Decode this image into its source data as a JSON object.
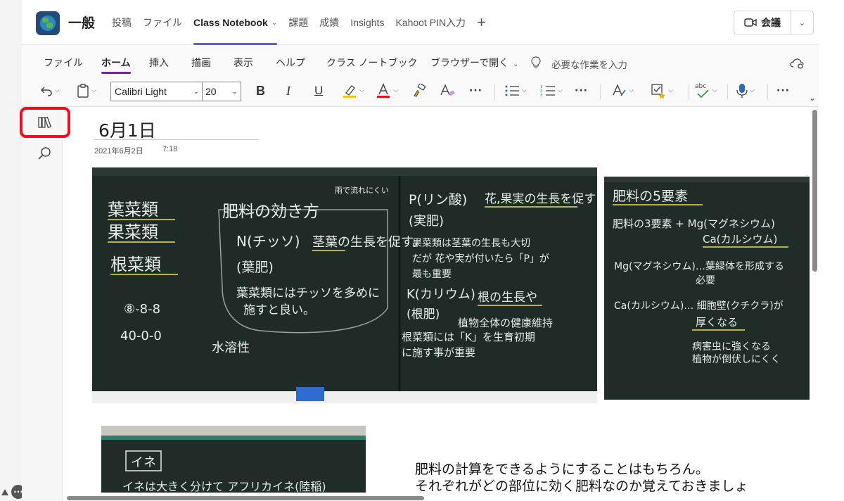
{
  "header": {
    "channel": "一般",
    "tabs": [
      {
        "label": "投稿"
      },
      {
        "label": "ファイル"
      },
      {
        "label": "Class Notebook",
        "has_caret": true,
        "active": true
      },
      {
        "label": "課題"
      },
      {
        "label": "成績"
      },
      {
        "label": "Insights"
      },
      {
        "label": "Kahoot PIN入力"
      },
      {
        "label": "+"
      }
    ],
    "meeting_label": "会議"
  },
  "ribbon": {
    "tabs": [
      "ファイル",
      "ホーム",
      "挿入",
      "描画",
      "表示",
      "ヘルプ",
      "クラス ノートブック",
      "ブラウザーで開く"
    ],
    "active_tab": "ホーム",
    "task_search": "必要な作業を入力",
    "font": "Calibri Light",
    "size": "20",
    "bold": "B",
    "italic": "I",
    "underline": "U",
    "more": "···",
    "spell": "abc",
    "highlight_color": "#f2c811",
    "font_color": "#e81123",
    "accent": "#6a2c91"
  },
  "page": {
    "title": "6月1日",
    "date": "2021年6月2日",
    "time": "7:18",
    "body_lines": [
      "肥料の計算をできるようにすることはもちろん。",
      "それぞれがどの部位に効く肥料なのか覚えておきましょ"
    ]
  },
  "board1": {
    "left_list": [
      "葉菜類",
      "果菜類",
      "根菜類"
    ],
    "title": "肥料の効き方",
    "note_top": "雨で流れにくい",
    "n_label": "N(チッソ)",
    "n_desc": "茎葉の生長を促す。",
    "n_type": "(葉肥)",
    "n_note1": "葉菜類にはチッソを多めに",
    "n_note2": "施すと良い。",
    "ratio1": "⑧-8-8",
    "ratio2": "40-0-0",
    "water": "水溶性",
    "p_label": "P(リン酸)",
    "p_desc": "花,果実の生長を促す",
    "p_type": "(実肥)",
    "p_note1": "果菜類は茎葉の生長も大切",
    "p_note2": "だが 花や実が付いたら「P」が",
    "p_note3": "最も重要",
    "k_label": "K(カリウム)",
    "k_desc": "根の生長や",
    "k_type": "(根肥)",
    "k_desc2": "植物全体の健康維持",
    "k_note1": "根菜類には「K」を生育初期",
    "k_note2": "に施す事が重要"
  },
  "board2": {
    "title": "肥料の5要素",
    "line1": "肥料の3要素 + Mg(マグネシウム)",
    "line2": "Ca(カルシウム)",
    "mg": "Mg(マグネシウム)…葉緑体を形成する",
    "mg2": "必要",
    "ca": "Ca(カルシウム)… 細胞壁(クチクラ)が",
    "ca2": "厚くなる",
    "ca3": "病害虫に強くなる",
    "ca4": "植物が倒伏しにくく"
  },
  "board3": {
    "label": "イネ",
    "line": "イネは大きく分けて アフリカイネ(陸稲)"
  }
}
